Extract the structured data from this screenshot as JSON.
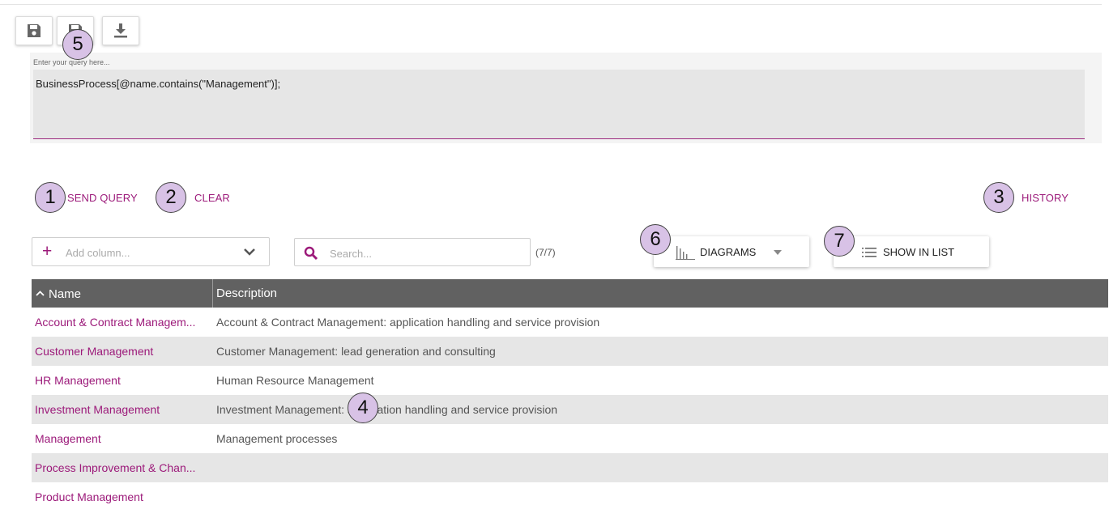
{
  "toolbar": {
    "buttons": [
      {
        "icon": "save-icon"
      },
      {
        "icon": "save-as-icon"
      },
      {
        "icon": "download-icon"
      }
    ]
  },
  "query": {
    "hint": "Enter your query here...",
    "value": "BusinessProcess[@name.contains(\"Management\")];"
  },
  "actions": {
    "send_query": "SEND QUERY",
    "clear": "CLEAR",
    "history": "HISTORY"
  },
  "controls": {
    "add_column_placeholder": "Add column...",
    "search_placeholder": "Search...",
    "result_count": "(7/7)",
    "diagrams_label": "DIAGRAMS",
    "show_in_list_label": "SHOW IN LIST"
  },
  "callouts": {
    "c1": "1",
    "c2": "2",
    "c3": "3",
    "c4": "4",
    "c5": "5",
    "c6": "6",
    "c7": "7"
  },
  "table": {
    "columns": [
      "Name",
      "Description"
    ],
    "sort": {
      "column": "Name",
      "direction": "ascending"
    },
    "rows": [
      {
        "name": "Account & Contract Managem...",
        "description": "Account & Contract Management: application handling and service provision"
      },
      {
        "name": "Customer Management",
        "description": "Customer Management: lead generation and consulting"
      },
      {
        "name": "HR Management",
        "description": "Human Resource Management"
      },
      {
        "name": "Investment Management",
        "description": "Investment Management: application handling and service provision"
      },
      {
        "name": "Management",
        "description": "Management processes"
      },
      {
        "name": "Process Improvement & Chan...",
        "description": ""
      },
      {
        "name": "Product Management",
        "description": ""
      }
    ]
  },
  "colors": {
    "accent": "#9c1a7a",
    "header_bg": "#616161",
    "row_alt": "#e6e6e6",
    "callout_fill": "#d8c2e6"
  }
}
